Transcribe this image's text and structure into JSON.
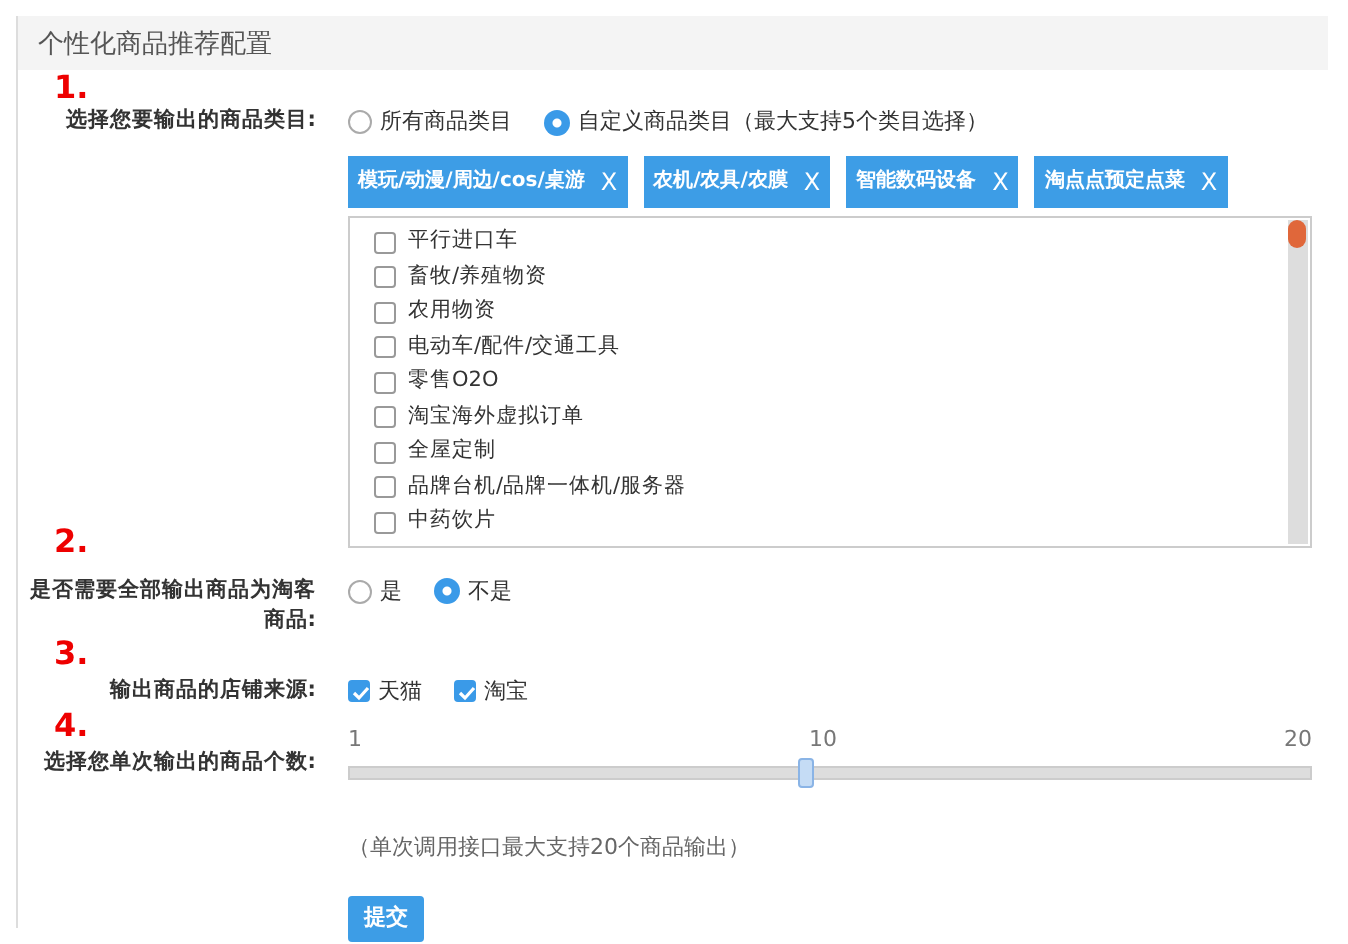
{
  "panel": {
    "title": "个性化商品推荐配置"
  },
  "sections": [
    {
      "kind": "category",
      "step": "1.",
      "label": "选择您要输出的商品类目:",
      "options": [
        {
          "label": "所有商品类目",
          "selected": false
        },
        {
          "label": "自定义商品类目（最大支持5个类目选择）",
          "selected": true
        }
      ],
      "tags": [
        {
          "label": "模玩/动漫/周边/cos/桌游",
          "remove": "X"
        },
        {
          "label": "农机/农具/农膜",
          "remove": "X"
        },
        {
          "label": "智能数码设备",
          "remove": "X"
        },
        {
          "label": "淘点点预定点菜",
          "remove": "X"
        }
      ],
      "items": [
        {
          "label": "平行进口车",
          "checked": false
        },
        {
          "label": "畜牧/养殖物资",
          "checked": false
        },
        {
          "label": "农用物资",
          "checked": false
        },
        {
          "label": "电动车/配件/交通工具",
          "checked": false
        },
        {
          "label": "零售O2O",
          "checked": false
        },
        {
          "label": "淘宝海外虚拟订单",
          "checked": false
        },
        {
          "label": "全屋定制",
          "checked": false
        },
        {
          "label": "品牌台机/品牌一体机/服务器",
          "checked": false
        },
        {
          "label": "中药饮片",
          "checked": false
        }
      ]
    },
    {
      "kind": "radio",
      "step": "2.",
      "label": "是否需要全部输出商品为淘客商品:",
      "options": [
        {
          "label": "是",
          "selected": false
        },
        {
          "label": "不是",
          "selected": true
        }
      ]
    },
    {
      "kind": "checkbox",
      "step": "3.",
      "label": "输出商品的店铺来源:",
      "options": [
        {
          "label": "天猫",
          "checked": true
        },
        {
          "label": "淘宝",
          "checked": true
        }
      ]
    },
    {
      "kind": "slider",
      "step": "4.",
      "label": "选择您单次输出的商品个数:",
      "ticks": [
        "1",
        "10",
        "20"
      ],
      "level": 0.474,
      "note": "（单次调用接口最大支持20个商品输出）"
    }
  ],
  "submit": "提交"
}
